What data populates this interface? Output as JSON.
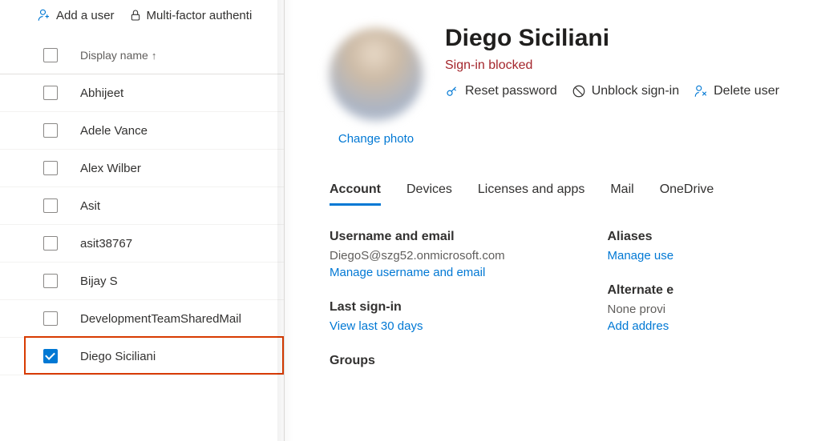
{
  "toolbar": {
    "add_user": "Add a user",
    "mfa": "Multi-factor authenti"
  },
  "list": {
    "column_header": "Display name",
    "rows": [
      {
        "name": "Abhijeet",
        "selected": false
      },
      {
        "name": "Adele Vance",
        "selected": false
      },
      {
        "name": "Alex Wilber",
        "selected": false
      },
      {
        "name": "Asit",
        "selected": false
      },
      {
        "name": "asit38767",
        "selected": false
      },
      {
        "name": "Bijay S",
        "selected": false
      },
      {
        "name": "DevelopmentTeamSharedMail",
        "selected": false
      },
      {
        "name": "Diego Siciliani",
        "selected": true
      }
    ]
  },
  "detail": {
    "name": "Diego Siciliani",
    "status": "Sign-in blocked",
    "change_photo": "Change photo",
    "actions": {
      "reset_password": "Reset password",
      "unblock_signin": "Unblock sign-in",
      "delete_user": "Delete user"
    },
    "tabs": [
      "Account",
      "Devices",
      "Licenses and apps",
      "Mail",
      "OneDrive"
    ],
    "active_tab": 0,
    "sections": {
      "username_email": {
        "title": "Username and email",
        "value": "DiegoS@szg52.onmicrosoft.com",
        "link": "Manage username and email"
      },
      "last_signin": {
        "title": "Last sign-in",
        "link": "View last 30 days"
      },
      "groups_title": "Groups",
      "aliases": {
        "title": "Aliases",
        "link": "Manage use"
      },
      "alternate": {
        "title": "Alternate e",
        "value": "None provi",
        "link": "Add addres"
      }
    }
  }
}
